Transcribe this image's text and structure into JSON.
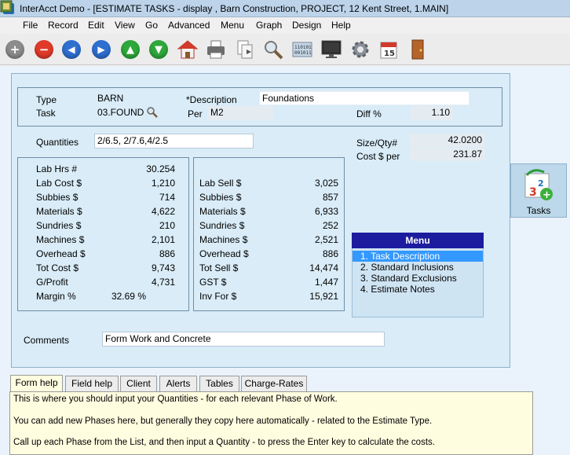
{
  "window": {
    "title": "InterAcct Demo - [ESTIMATE TASKS - display , Barn Construction, PROJECT, 12 Kent Street, 1.MAIN]"
  },
  "menubar": [
    "File",
    "Record",
    "Edit",
    "View",
    "Go",
    "Advanced",
    "Menu",
    "Graph",
    "Design",
    "Help"
  ],
  "toolbar": {
    "icons": [
      "add-icon",
      "delete-icon",
      "first-icon",
      "last-icon",
      "up-icon",
      "down-icon",
      "home-icon",
      "print-icon",
      "copy-icon",
      "search-icon",
      "binary-icon",
      "monitor-icon",
      "gear-icon",
      "calendar-icon",
      "exit-door-icon"
    ],
    "calendar_day": "15"
  },
  "header": {
    "type_label": "Type",
    "type_value": "BARN",
    "task_label": "Task",
    "task_value": "03.FOUND",
    "description_label": "*Description",
    "description_value": "Foundations",
    "per_label": "Per",
    "per_value": "M2",
    "diff_label": "Diff %",
    "diff_value": "1.10"
  },
  "quantities": {
    "label": "Quantities",
    "value": "2/6.5, 2/7.6,4/2.5",
    "size_qty_label": "Size/Qty#",
    "size_qty_value": "42.0200",
    "cost_per_label": "Cost $ per",
    "cost_per_value": "231.87"
  },
  "costs": [
    {
      "label": "Lab Hrs #",
      "value": "30.254"
    },
    {
      "label": "Lab Cost $",
      "value": "1,210"
    },
    {
      "label": "Subbies  $",
      "value": "714"
    },
    {
      "label": "Materials $",
      "value": "4,622"
    },
    {
      "label": "Sundries  $",
      "value": "210"
    },
    {
      "label": "Machines $",
      "value": "2,101"
    },
    {
      "label": "Overhead $",
      "value": "886"
    },
    {
      "label": "Tot Cost $",
      "value": "9,743"
    },
    {
      "label": "G/Profit",
      "value": "4,731"
    },
    {
      "label": "Margin %",
      "value": "32.69 %"
    }
  ],
  "sells": [
    {
      "label": "Lab Sell $",
      "value": "3,025"
    },
    {
      "label": "Subbies  $",
      "value": "857"
    },
    {
      "label": "Materials $",
      "value": "6,933"
    },
    {
      "label": "Sundries  $",
      "value": "252"
    },
    {
      "label": "Machines $",
      "value": "2,521"
    },
    {
      "label": "Overhead $",
      "value": "886"
    },
    {
      "label": "Tot Sell $",
      "value": "14,474"
    },
    {
      "label": "GST  $",
      "value": "1,447"
    },
    {
      "label": "Inv For $",
      "value": "15,921"
    }
  ],
  "menu": {
    "title": "Menu",
    "items": [
      "1. Task Description",
      "2. Standard Inclusions",
      "3. Standard Exclusions",
      "4. Estimate Notes"
    ]
  },
  "comments": {
    "label": "Comments",
    "value": "Form Work and Concrete"
  },
  "tasks_button": {
    "label": "Tasks"
  },
  "help_tabs": [
    "Form help",
    "Field help",
    "Client",
    "Alerts",
    "Tables",
    "Charge-Rates"
  ],
  "help_text": [
    "This is where you should input your Quantities - for each relevant Phase of Work.",
    "You can add new Phases here, but generally they copy here automatically - related to the Estimate Type.",
    "Call up each Phase from the List, and then input a Quantity - to press the Enter key to calculate the costs."
  ],
  "colors": {
    "title_bar": "#bcd3ea",
    "panel": "#d9ecf7",
    "menu_header": "#1c1c9e",
    "menu_selected": "#3399ff",
    "help_bg": "#fffde0"
  }
}
